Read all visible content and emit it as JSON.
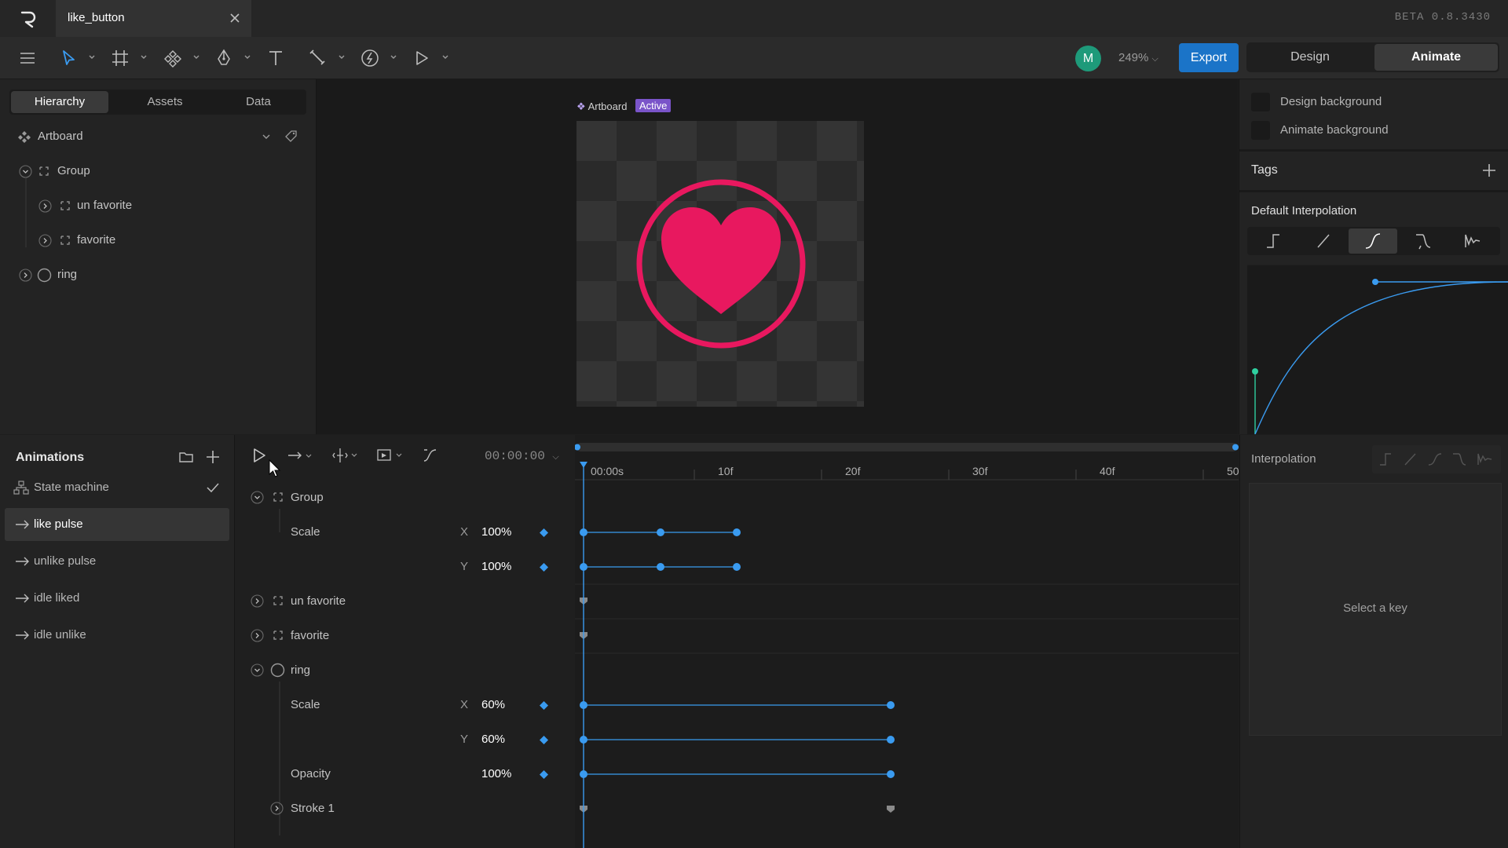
{
  "titlebar": {
    "doc_name": "like_button",
    "version": "BETA 0.8.3430"
  },
  "toolbar": {
    "avatar_initial": "M",
    "zoom": "249%",
    "export_label": "Export",
    "mode_design": "Design",
    "mode_animate": "Animate"
  },
  "hierarchy": {
    "tabs": [
      "Hierarchy",
      "Assets",
      "Data"
    ],
    "root": "Artboard",
    "items": [
      {
        "label": "Group"
      },
      {
        "label": "un favorite"
      },
      {
        "label": "favorite"
      },
      {
        "label": "ring"
      }
    ]
  },
  "canvas": {
    "artboard_label": "Artboard",
    "badge": "Active"
  },
  "inspector": {
    "design_background": "Design background",
    "animate_background": "Animate background",
    "tags": "Tags",
    "default_interpolation": "Default Interpolation"
  },
  "animations": {
    "title": "Animations",
    "state_machine": "State machine",
    "items": [
      "like pulse",
      "unlike pulse",
      "idle liked",
      "idle unlike"
    ]
  },
  "timeline": {
    "timecode": "00:00:00",
    "ruler": [
      "00:00s",
      "10f",
      "20f",
      "30f",
      "40f",
      "50"
    ],
    "rows": {
      "group": "Group",
      "group_scale": "Scale",
      "group_scale_x_axis": "X",
      "group_scale_x": "100%",
      "group_scale_y_axis": "Y",
      "group_scale_y": "100%",
      "unfavorite": "un favorite",
      "favorite": "favorite",
      "ring": "ring",
      "ring_scale": "Scale",
      "ring_scale_x_axis": "X",
      "ring_scale_x": "60%",
      "ring_scale_y_axis": "Y",
      "ring_scale_y": "60%",
      "ring_opacity": "Opacity",
      "ring_opacity_val": "100%",
      "stroke": "Stroke 1"
    }
  },
  "interpolation_panel": {
    "title": "Interpolation",
    "empty_text": "Select a key"
  },
  "colors": {
    "accent": "#1b74c8",
    "key_blue": "#3a9bf0",
    "heart": "#e8185f",
    "active_badge": "#7a54c9"
  }
}
